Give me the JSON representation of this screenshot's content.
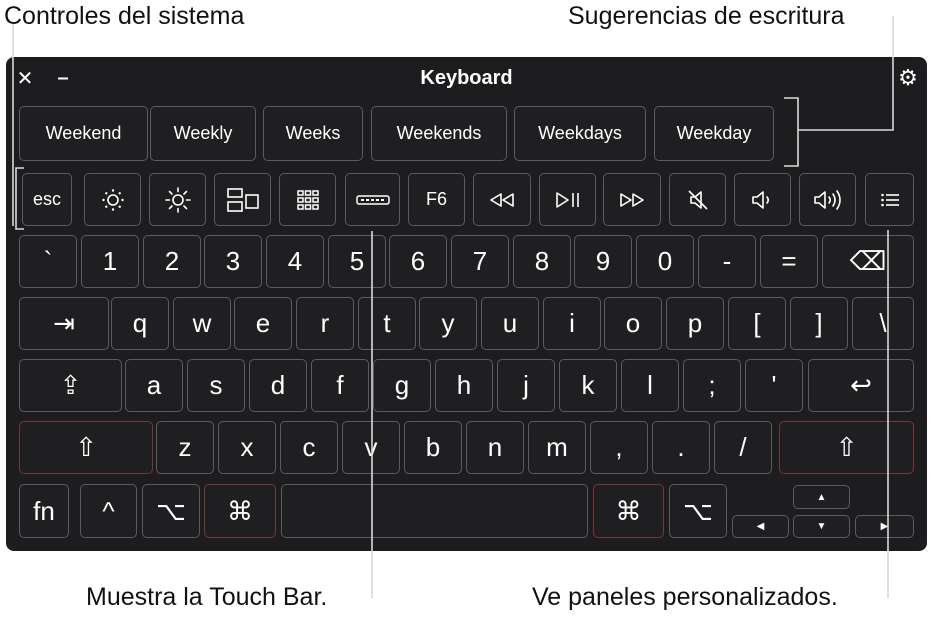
{
  "callouts": {
    "system_controls": "Controles del sistema",
    "typing_suggestions": "Sugerencias de escritura",
    "show_touch_bar": "Muestra la Touch Bar.",
    "custom_panels": "Ve paneles personalizados."
  },
  "window": {
    "title": "Keyboard",
    "close_glyph": "✕",
    "minimize_glyph": "–",
    "settings_glyph": "⚙"
  },
  "suggestions": [
    "Weekend",
    "Weekly",
    "Weeks",
    "Weekends",
    "Weekdays",
    "Weekday"
  ],
  "system_row": {
    "esc": "esc",
    "f6": "F6",
    "icons": [
      "brightness-down-icon",
      "brightness-up-icon",
      "mission-control-icon",
      "launchpad-icon",
      "touch-bar-icon",
      "rewind-icon",
      "play-pause-icon",
      "fast-forward-icon",
      "mute-icon",
      "volume-down-icon",
      "volume-up-icon",
      "custom-panels-icon"
    ]
  },
  "keys": {
    "number_row": [
      "`",
      "1",
      "2",
      "3",
      "4",
      "5",
      "6",
      "7",
      "8",
      "9",
      "0",
      "-",
      "=",
      "⌫"
    ],
    "top_row": [
      "⇥",
      "q",
      "w",
      "e",
      "r",
      "t",
      "y",
      "u",
      "i",
      "o",
      "p",
      "[",
      "]",
      "\\"
    ],
    "home_row": [
      "⇪",
      "a",
      "s",
      "d",
      "f",
      "g",
      "h",
      "j",
      "k",
      "l",
      ";",
      "'",
      "↩"
    ],
    "bottom_row": [
      "⇧",
      "z",
      "x",
      "c",
      "v",
      "b",
      "n",
      "m",
      ",",
      ".",
      "/",
      "⇧"
    ],
    "modifier_row": {
      "fn": "fn",
      "control": "^",
      "option_left": "⌥",
      "command_left": "⌘",
      "space": "",
      "command_right": "⌘",
      "option_right": "⌥"
    },
    "arrows": {
      "up": "▲",
      "left": "◀",
      "down": "▼",
      "right": "▶"
    }
  },
  "colors": {
    "panel_bg": "#1d1d1f",
    "key_bg": "#1f1f21",
    "key_border": "#5c5c60",
    "modifier_border": "#7a3535",
    "text": "#ffffff"
  }
}
